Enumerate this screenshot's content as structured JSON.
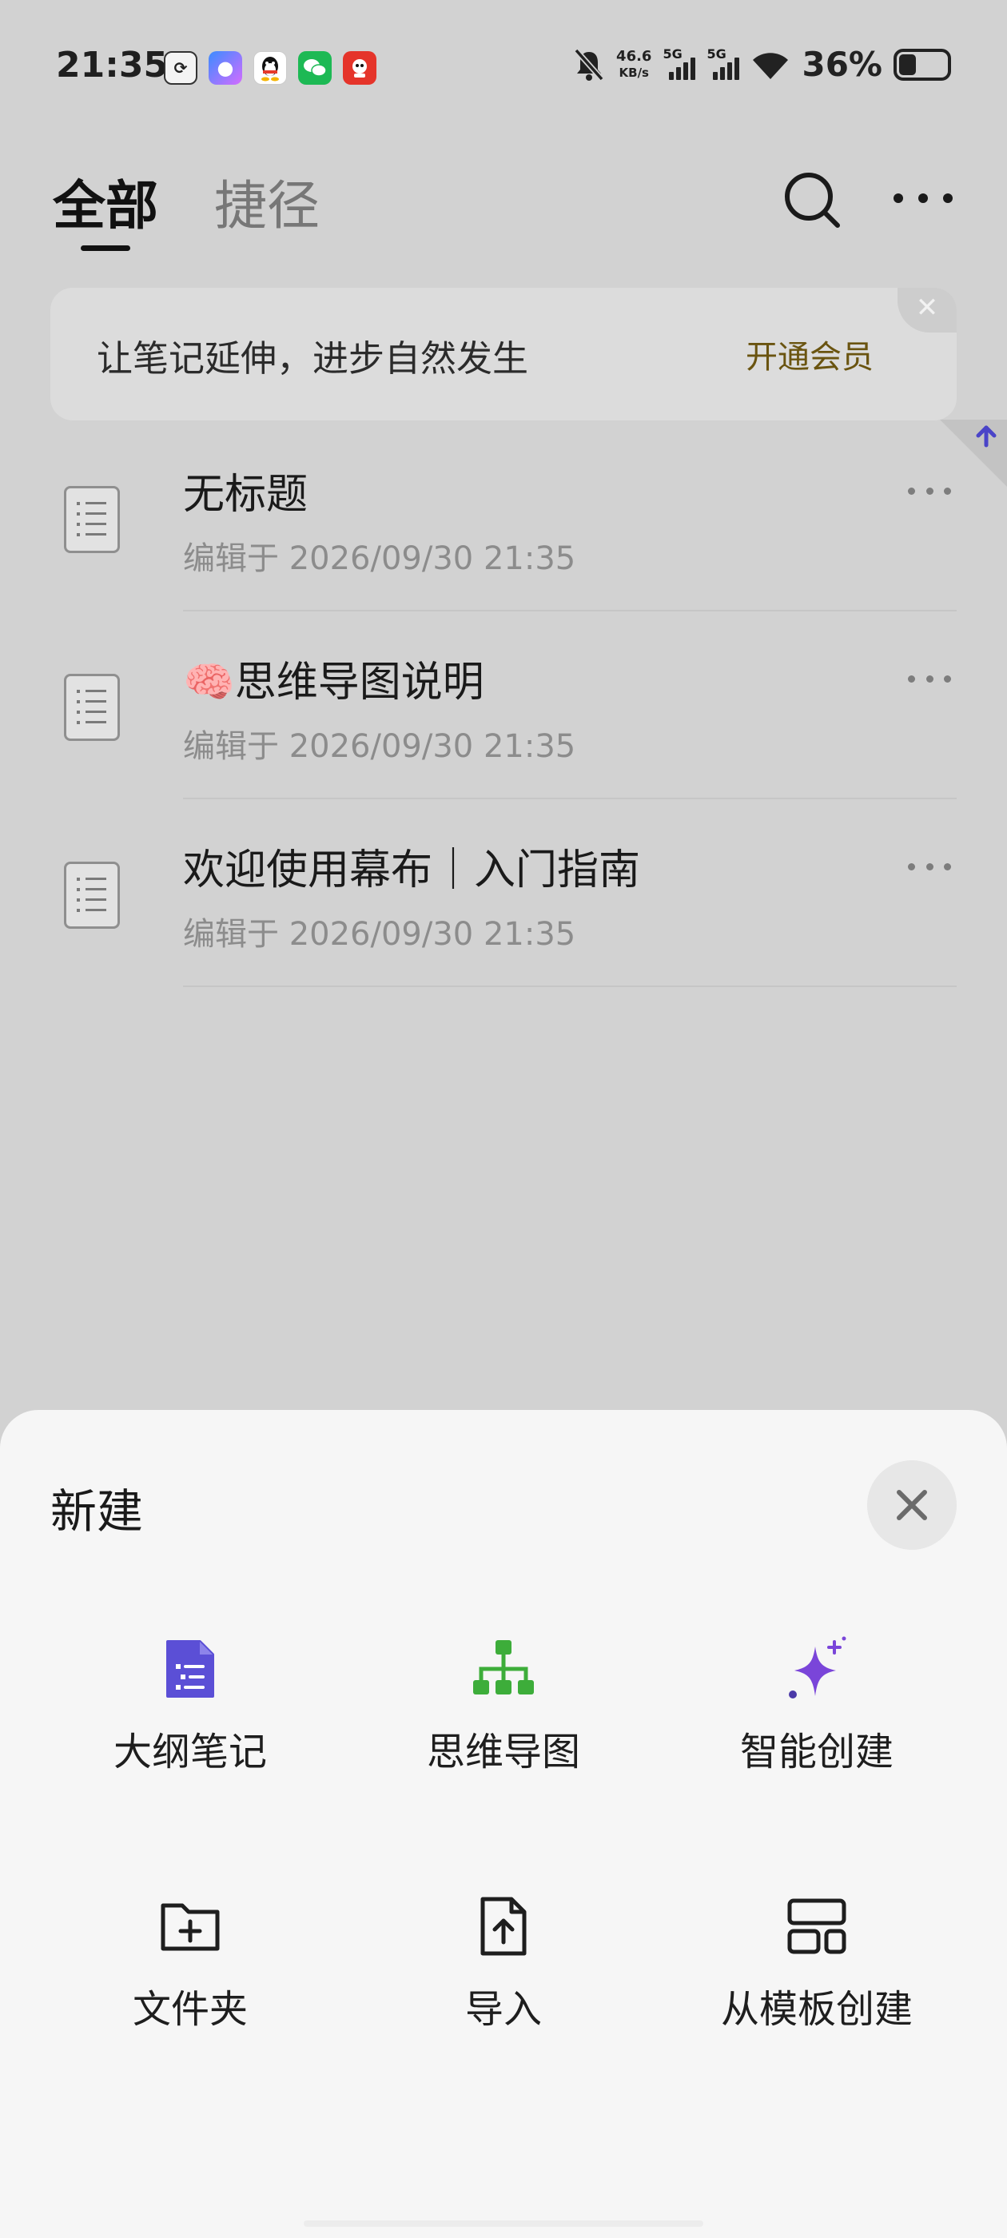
{
  "status_bar": {
    "time": "21:35",
    "apps": [
      "tasks-app-icon",
      "wallet-app-icon",
      "qq-icon",
      "wechat-icon",
      "red-app-icon"
    ],
    "net_speed_value": "46.6",
    "net_speed_unit": "KB/s",
    "sim1": "5G",
    "sim2": "5G",
    "battery_percent": "36%",
    "battery_level": 0.36
  },
  "header": {
    "tabs": [
      {
        "label": "全部",
        "active": true
      },
      {
        "label": "捷径",
        "active": false
      }
    ]
  },
  "banner": {
    "text": "让笔记延伸，进步自然发生",
    "cta": "开通会员"
  },
  "documents": [
    {
      "title": "无标题",
      "edited": "编辑于 2026/09/30 21:35"
    },
    {
      "title": "🧠思维导图说明",
      "edited": "编辑于 2026/09/30 21:35"
    },
    {
      "title": "欢迎使用幕布｜入门指南",
      "edited": "编辑于 2026/09/30 21:35"
    }
  ],
  "sheet": {
    "title": "新建",
    "options": [
      {
        "label": "大纲笔记",
        "icon": "outline-note-icon",
        "color": "#5b4fd6"
      },
      {
        "label": "思维导图",
        "icon": "mind-map-icon",
        "color": "#3dad3a"
      },
      {
        "label": "智能创建",
        "icon": "sparkle-icon",
        "color": "#7a45d9"
      },
      {
        "label": "文件夹",
        "icon": "folder-add-icon",
        "color": "#1e1e1e"
      },
      {
        "label": "导入",
        "icon": "import-file-icon",
        "color": "#1e1e1e"
      },
      {
        "label": "从模板创建",
        "icon": "template-icon",
        "color": "#1e1e1e"
      }
    ]
  }
}
